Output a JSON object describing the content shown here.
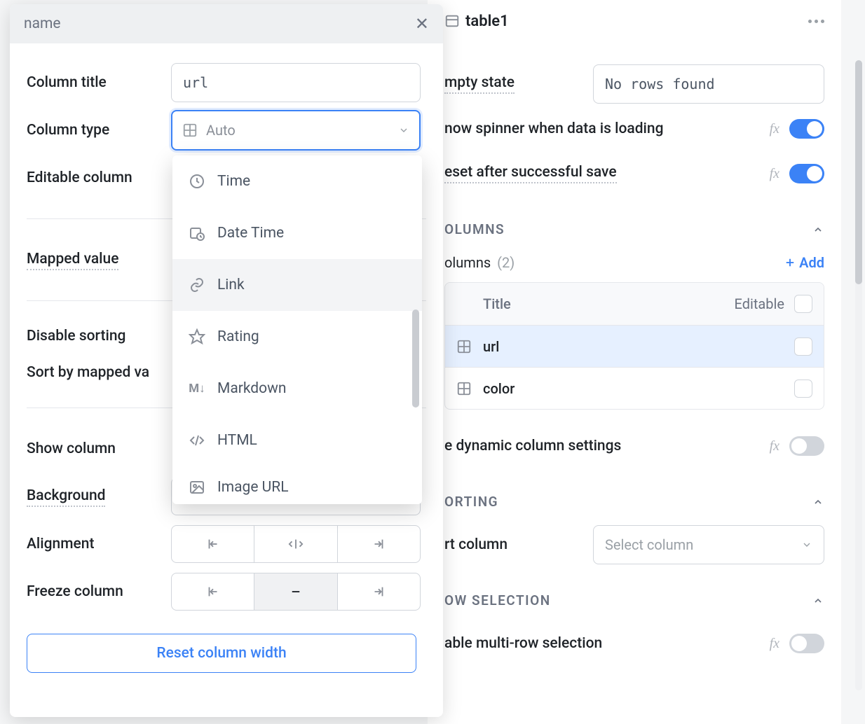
{
  "right": {
    "table_name": "table1",
    "empty_state_label": "mpty state",
    "empty_state_value": "No rows found",
    "spinner_label": "now spinner when data is loading",
    "reset_save_label": "eset after successful save",
    "columns_header": "OLUMNS",
    "columns_label": "olumns",
    "columns_count": "(2)",
    "add_label": "Add",
    "title_header": "Title",
    "editable_header": "Editable",
    "col_rows": [
      {
        "name": "url",
        "selected": true
      },
      {
        "name": "color",
        "selected": false
      }
    ],
    "dynamic_label": "e dynamic column settings",
    "sorting_header": "ORTING",
    "sort_column_label": "rt column",
    "sort_placeholder": "Select column",
    "row_selection_header": "OW SELECTION",
    "multi_row_label": "able multi-row selection"
  },
  "dialog": {
    "header": "name",
    "column_title_label": "Column title",
    "column_title_value": "url",
    "column_type_label": "Column type",
    "column_type_value": "Auto",
    "editable_label": "Editable column",
    "mapped_value_label": "Mapped value",
    "disable_sorting_label": "Disable sorting",
    "sort_by_mapped_label": "Sort by mapped va",
    "show_column_label": "Show column",
    "background_label": "Background",
    "alignment_label": "Alignment",
    "freeze_label": "Freeze column",
    "reset_button": "Reset column width"
  },
  "dropdown": {
    "options": [
      {
        "id": "time",
        "label": "Time"
      },
      {
        "id": "date-time",
        "label": "Date Time"
      },
      {
        "id": "link",
        "label": "Link",
        "hover": true
      },
      {
        "id": "rating",
        "label": "Rating"
      },
      {
        "id": "markdown",
        "label": "Markdown"
      },
      {
        "id": "html",
        "label": "HTML"
      },
      {
        "id": "image-url",
        "label": "Image URL"
      }
    ]
  }
}
